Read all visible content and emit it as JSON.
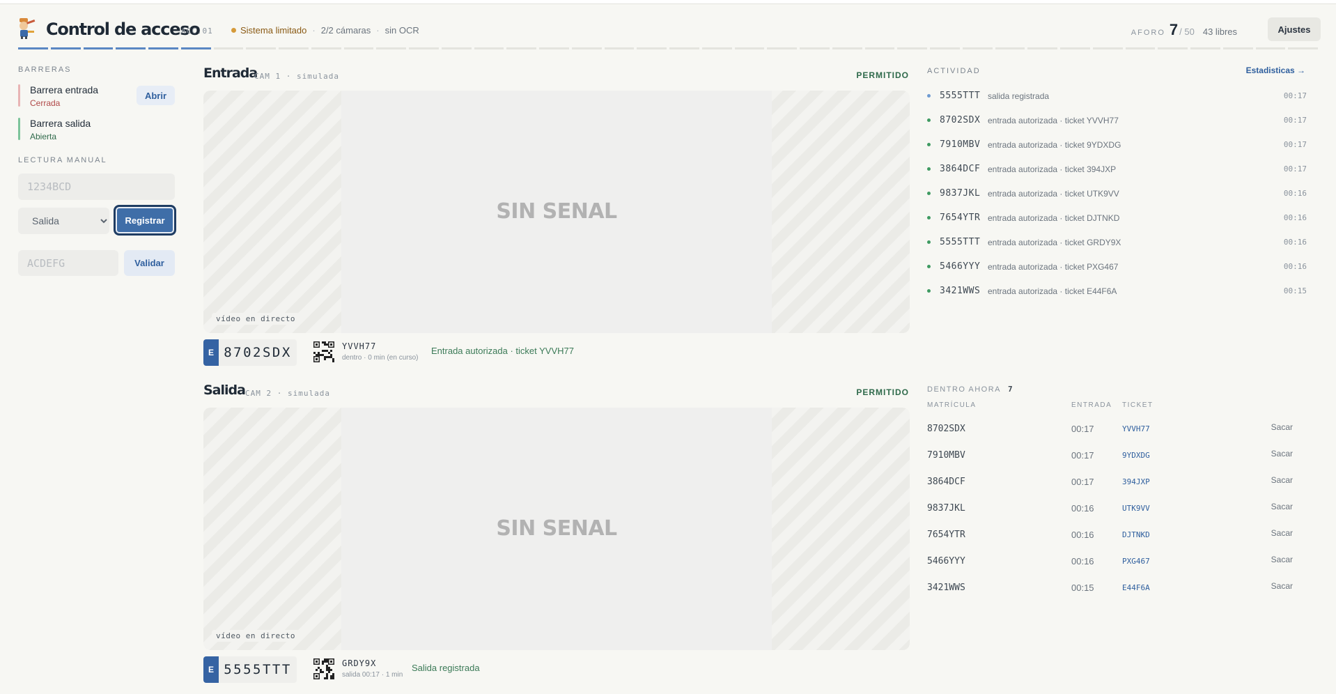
{
  "header": {
    "title": "Control de acceso",
    "code": "ACC.01",
    "status_warning": "Sistema limitado",
    "cameras": "2/2 cámaras",
    "ocr": "sin OCR",
    "aforo_label": "AFORO",
    "aforo_count": "7",
    "aforo_total": "/ 50",
    "aforo_free": "43 libres",
    "settings_label": "Ajustes",
    "progress_active_segments": 6,
    "progress_total_segments": 40
  },
  "sidebar": {
    "barriers_label": "BARRERAS",
    "barriers": [
      {
        "name": "Barrera entrada",
        "state": "Cerrada",
        "color": "#e8b4b4",
        "state_color": "#b04848",
        "action": "Abrir"
      },
      {
        "name": "Barrera salida",
        "state": "Abierta",
        "color": "#7cc49a",
        "state_color": "#2f6a4b"
      }
    ],
    "manual_label": "LECTURA MANUAL",
    "plate_placeholder": "1234BCD",
    "direction_selected": "Salida",
    "register_label": "Registrar",
    "ticket_placeholder": "ACDEFG",
    "validate_label": "Validar"
  },
  "cameras": [
    {
      "title": "Entrada",
      "subtitle": "CAM 1 · simulada",
      "status": "PERMITIDO",
      "no_signal": "SIN SENAL",
      "live": "vídeo en directo",
      "plate_prefix": "E",
      "plate": "8702SDX",
      "ticket": "YVVH77",
      "ticket_detail": "dentro · 0 min (en curso)",
      "message": "Entrada autorizada · ticket YVVH77"
    },
    {
      "title": "Salida",
      "subtitle": "CAM 2 · simulada",
      "status": "PERMITIDO",
      "no_signal": "SIN SENAL",
      "live": "vídeo en directo",
      "plate_prefix": "E",
      "plate": "5555TTT",
      "ticket": "GRDY9X",
      "ticket_detail": "salida 00:17 · 1 min",
      "message": "Salida registrada"
    }
  ],
  "activity": {
    "label": "ACTIVIDAD",
    "stats_link": "Estadisticas →",
    "items": [
      {
        "plate": "5555TTT",
        "text": "salida registrada",
        "time": "00:17",
        "dot": "#6f9bd1"
      },
      {
        "plate": "8702SDX",
        "text": "entrada autorizada · ticket YVVH77",
        "time": "00:17",
        "dot": "#3f9a62"
      },
      {
        "plate": "7910MBV",
        "text": "entrada autorizada · ticket 9YDXDG",
        "time": "00:17",
        "dot": "#3f9a62"
      },
      {
        "plate": "3864DCF",
        "text": "entrada autorizada · ticket 394JXP",
        "time": "00:17",
        "dot": "#3f9a62"
      },
      {
        "plate": "9837JKL",
        "text": "entrada autorizada · ticket UTK9VV",
        "time": "00:16",
        "dot": "#3f9a62"
      },
      {
        "plate": "7654YTR",
        "text": "entrada autorizada · ticket DJTNKD",
        "time": "00:16",
        "dot": "#3f9a62"
      },
      {
        "plate": "5555TTT",
        "text": "entrada autorizada · ticket GRDY9X",
        "time": "00:16",
        "dot": "#3f9a62"
      },
      {
        "plate": "5466YYY",
        "text": "entrada autorizada · ticket PXG467",
        "time": "00:16",
        "dot": "#3f9a62"
      },
      {
        "plate": "3421WWS",
        "text": "entrada autorizada · ticket E44F6A",
        "time": "00:15",
        "dot": "#3f9a62"
      }
    ]
  },
  "inside": {
    "label": "DENTRO AHORA",
    "count": "7",
    "columns": [
      "MATRÍCULA",
      "ENTRADA",
      "TICKET"
    ],
    "action": "Sacar",
    "rows": [
      {
        "plate": "8702SDX",
        "entry": "00:17",
        "ticket": "YVVH77"
      },
      {
        "plate": "7910MBV",
        "entry": "00:17",
        "ticket": "9YDXDG"
      },
      {
        "plate": "3864DCF",
        "entry": "00:17",
        "ticket": "394JXP"
      },
      {
        "plate": "9837JKL",
        "entry": "00:16",
        "ticket": "UTK9VV"
      },
      {
        "plate": "7654YTR",
        "entry": "00:16",
        "ticket": "DJTNKD"
      },
      {
        "plate": "5466YYY",
        "entry": "00:16",
        "ticket": "PXG467"
      },
      {
        "plate": "3421WWS",
        "entry": "00:15",
        "ticket": "E44F6A"
      }
    ]
  }
}
